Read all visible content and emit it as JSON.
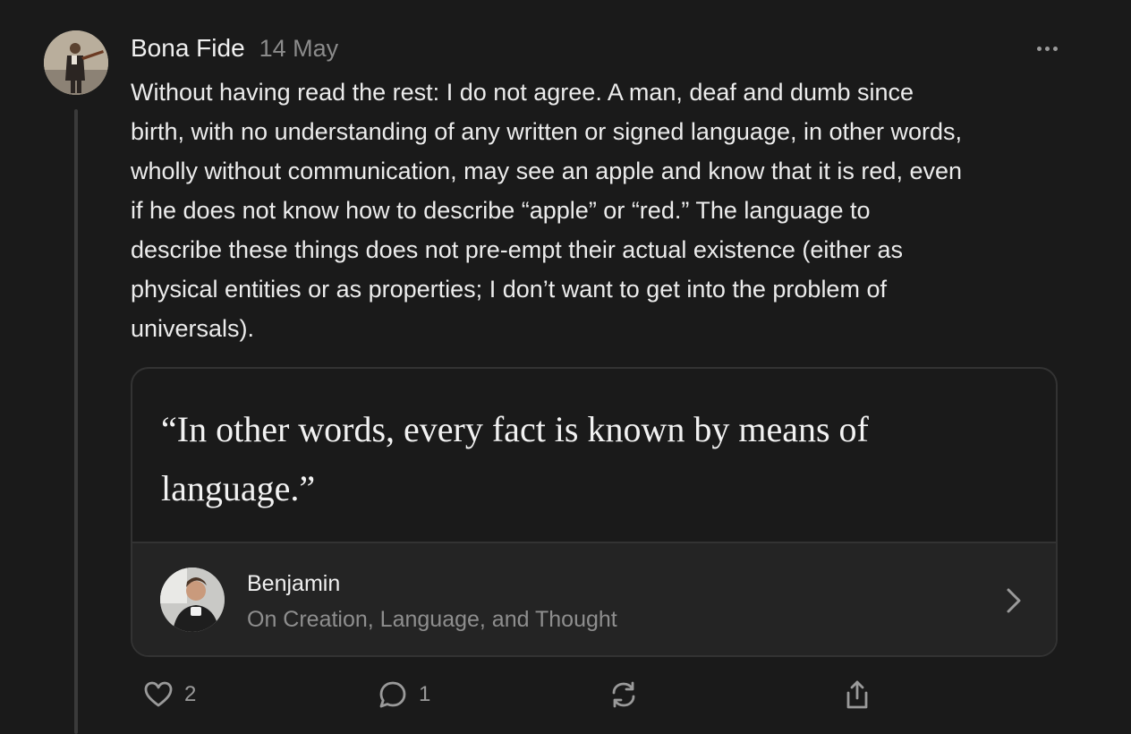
{
  "comment": {
    "author": "Bona Fide",
    "date": "14 May",
    "more_icon": "ellipsis-icon",
    "body": "Without having read the rest: I do not agree. A man, deaf and dumb since\nbirth, with no understanding of any written or signed language, in other words,\nwholly without communication, may see an apple and know that it is red, even\nif he does not know how to describe “apple” or “red.” The language to\ndescribe these things does not pre-empt their actual existence (either as\nphysical entities or as properties; I don’t want to get into the problem of\nuniversals)."
  },
  "quote": {
    "text": "“In other words, every fact is known by means of language.”",
    "source_author": "Benjamin",
    "source_title": "On Creation, Language, and Thought",
    "chevron_icon": "chevron-right-icon"
  },
  "actions": {
    "like": {
      "icon": "heart-icon",
      "count": "2"
    },
    "reply": {
      "icon": "comment-icon",
      "count": "1"
    },
    "restack": {
      "icon": "restack-icon"
    },
    "share": {
      "icon": "share-icon"
    }
  },
  "colors": {
    "background": "#1a1a1a",
    "card_footer": "#242424",
    "border": "#333333",
    "muted_text": "#8b8b8b"
  }
}
